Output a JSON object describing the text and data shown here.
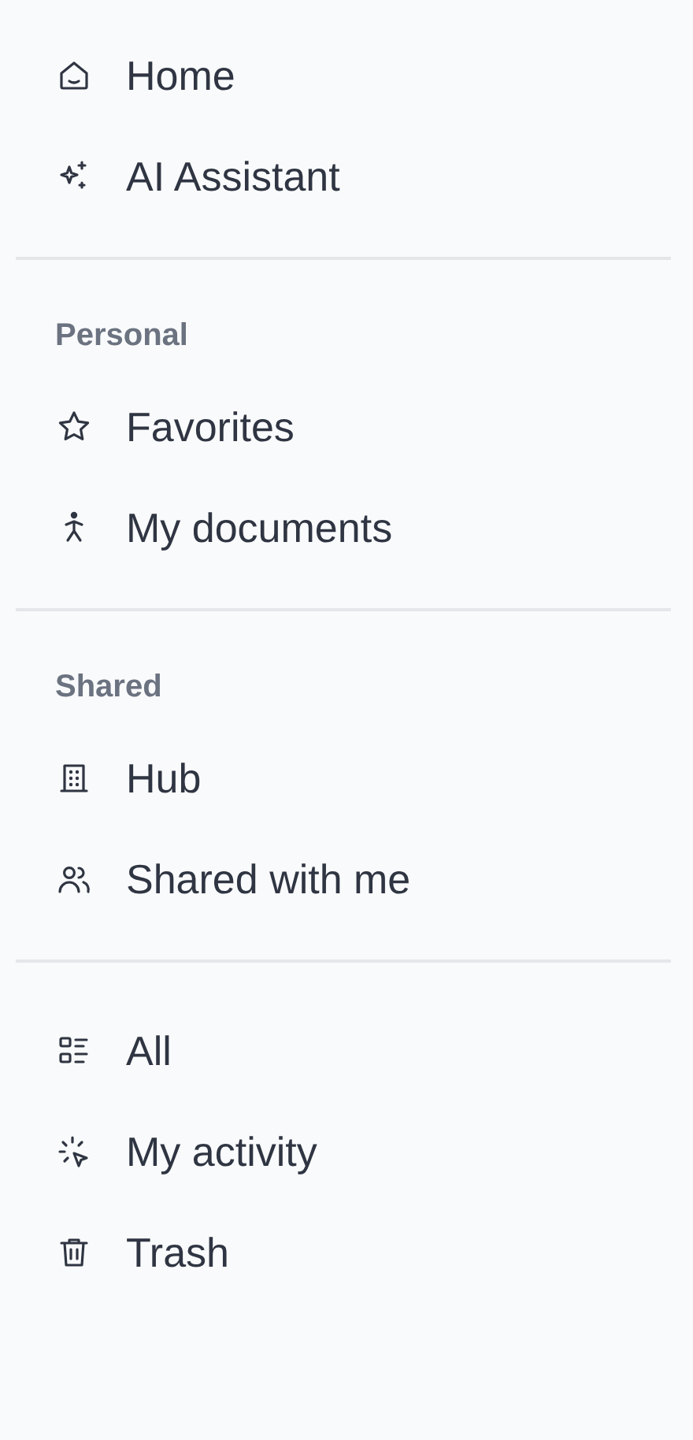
{
  "sections": [
    {
      "items": [
        {
          "label": "Home"
        },
        {
          "label": "AI Assistant"
        }
      ]
    },
    {
      "heading": "Personal",
      "items": [
        {
          "label": "Favorites"
        },
        {
          "label": "My documents"
        }
      ]
    },
    {
      "heading": "Shared",
      "items": [
        {
          "label": "Hub"
        },
        {
          "label": "Shared with me"
        }
      ]
    },
    {
      "items": [
        {
          "label": "All"
        },
        {
          "label": "My activity"
        },
        {
          "label": "Trash"
        }
      ]
    }
  ]
}
